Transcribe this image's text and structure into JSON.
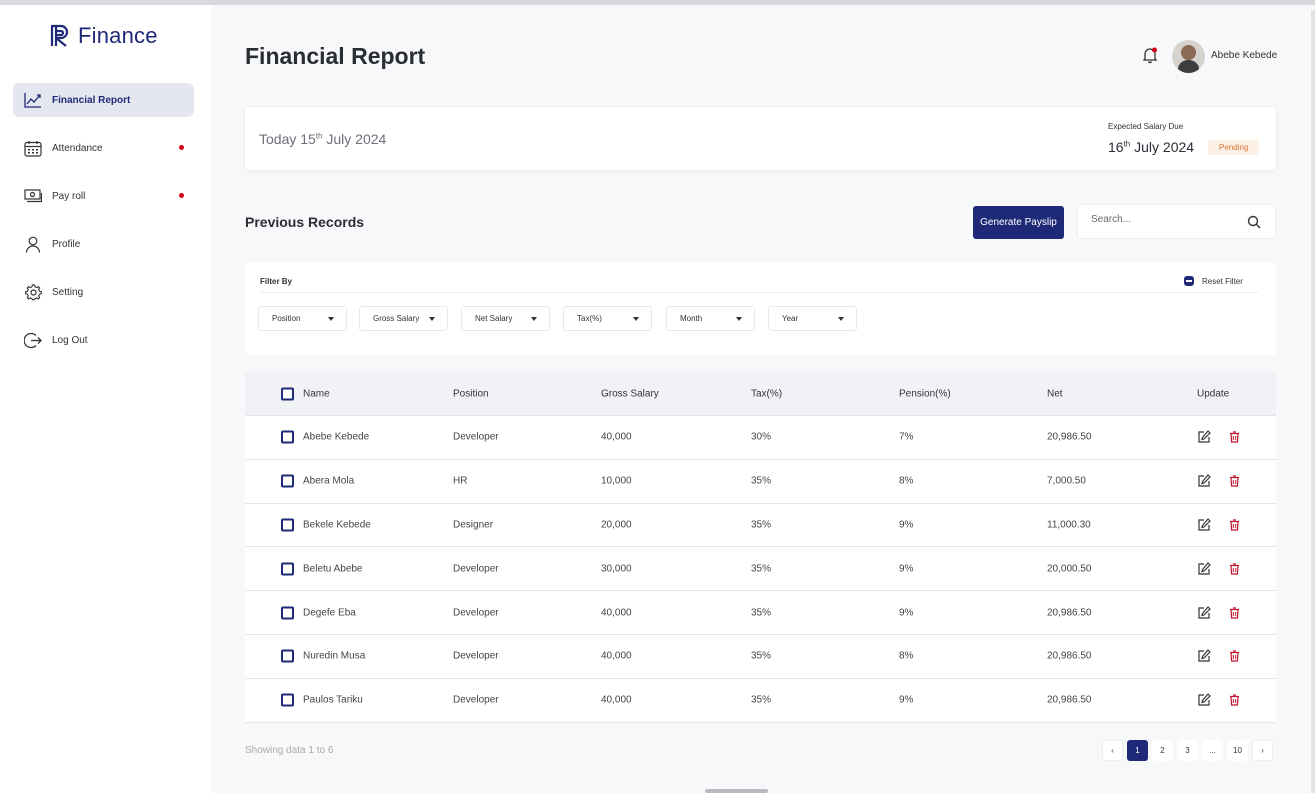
{
  "app": {
    "name": "Finance"
  },
  "sidebar": {
    "items": [
      {
        "label": "Financial Report",
        "icon": "chart-line-icon",
        "active": true,
        "dot": false
      },
      {
        "label": "Attendance",
        "icon": "calendar-icon",
        "active": false,
        "dot": true
      },
      {
        "label": "Pay roll",
        "icon": "money-icon",
        "active": false,
        "dot": true
      },
      {
        "label": "Profile",
        "icon": "user-icon",
        "active": false,
        "dot": false
      },
      {
        "label": "Setting",
        "icon": "gear-icon",
        "active": false,
        "dot": false
      },
      {
        "label": "Log Out",
        "icon": "logout-icon",
        "active": false,
        "dot": false
      }
    ]
  },
  "header": {
    "title": "Financial Report",
    "user_name": "Abebe Kebede"
  },
  "date_card": {
    "today_prefix": "Today 15",
    "today_sup": "th",
    "today_suffix": "July 2024",
    "due_label": "Expected Salary Due",
    "due_prefix": "16",
    "due_sup": "th",
    "due_suffix": "July 2024",
    "status": "Pending"
  },
  "records": {
    "title": "Previous Records",
    "generate_label": "Generate Payslip",
    "search_placeholder": "Search..."
  },
  "filters": {
    "label": "Filter By",
    "reset_label": "Reset Filter",
    "dropdowns": [
      "Position",
      "Gross Salary",
      "Net Salary",
      "Tax(%)",
      "Month",
      "Year"
    ]
  },
  "table": {
    "headers": {
      "name": "Name",
      "position": "Position",
      "gross": "Gross Salary",
      "tax": "Tax(%)",
      "pension": "Pension(%)",
      "net": "Net",
      "update": "Update"
    },
    "rows": [
      {
        "name": "Abebe Kebede",
        "position": "Developer",
        "gross": "40,000",
        "tax": "30%",
        "pension": "7%",
        "net": "20,986.50"
      },
      {
        "name": "Abera Mola",
        "position": "HR",
        "gross": "10,000",
        "tax": "35%",
        "pension": "8%",
        "net": "7,000.50"
      },
      {
        "name": "Bekele Kebede",
        "position": "Designer",
        "gross": "20,000",
        "tax": "35%",
        "pension": "9%",
        "net": "11,000.30"
      },
      {
        "name": "Beletu Abebe",
        "position": "Developer",
        "gross": "30,000",
        "tax": "35%",
        "pension": "9%",
        "net": "20,000.50"
      },
      {
        "name": "Degefe Eba",
        "position": "Developer",
        "gross": "40,000",
        "tax": "35%",
        "pension": "9%",
        "net": "20,986.50"
      },
      {
        "name": "Nuredin Musa",
        "position": "Developer",
        "gross": "40,000",
        "tax": "35%",
        "pension": "8%",
        "net": "20,986.50"
      },
      {
        "name": "Paulos Tariku",
        "position": "Developer",
        "gross": "40,000",
        "tax": "35%",
        "pension": "9%",
        "net": "20,986.50"
      }
    ]
  },
  "footer": {
    "showing": "Showing data 1 to 6",
    "pages": [
      "1",
      "2",
      "3",
      "...",
      "10"
    ],
    "prev": "‹",
    "next": "›"
  },
  "colors": {
    "accent": "#1e2a78",
    "danger": "#d0021b",
    "pending_bg": "#fcefe3",
    "pending_text": "#d97a3a"
  }
}
